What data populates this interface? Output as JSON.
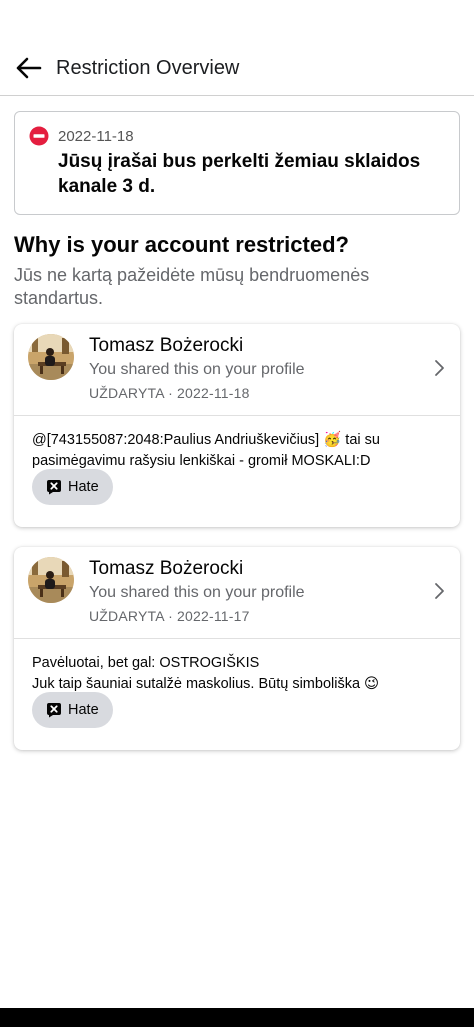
{
  "header": {
    "title": "Restriction Overview",
    "back_icon": "arrow-left-icon"
  },
  "alert": {
    "icon": "no-entry-icon",
    "icon_color": "#e41e3f",
    "date": "2022-11-18",
    "text": "Jūsų įrašai bus perkelti žemiau sklaidos kanale 3 d."
  },
  "section": {
    "heading": "Why is your account restricted?",
    "subheading": "Jūs ne kartą pažeidėte mūsų bendruomenės standartus."
  },
  "posts": [
    {
      "author": "Tomasz Bożerocki",
      "subtitle": "You shared this on your profile",
      "status": "UŽDARYTA · 2022-11-18",
      "text": "@[743155087:2048:Paulius Andriuškevičius] 🥳 tai su pasimėgavimu rašysiu lenkiškai - gromił MOSKALI:D",
      "tag_label": "Hate",
      "tag_icon": "x-square-icon"
    },
    {
      "author": "Tomasz Bożerocki",
      "subtitle": "You shared this on your profile",
      "status": "UŽDARYTA · 2022-11-17",
      "text": "Pavėluotai, bet gal: OSTROGIŠKIS\nJuk taip šauniai sutalžė maskolius. Būtų simboliška 😉",
      "tag_label": "Hate",
      "tag_icon": "x-square-icon"
    }
  ]
}
